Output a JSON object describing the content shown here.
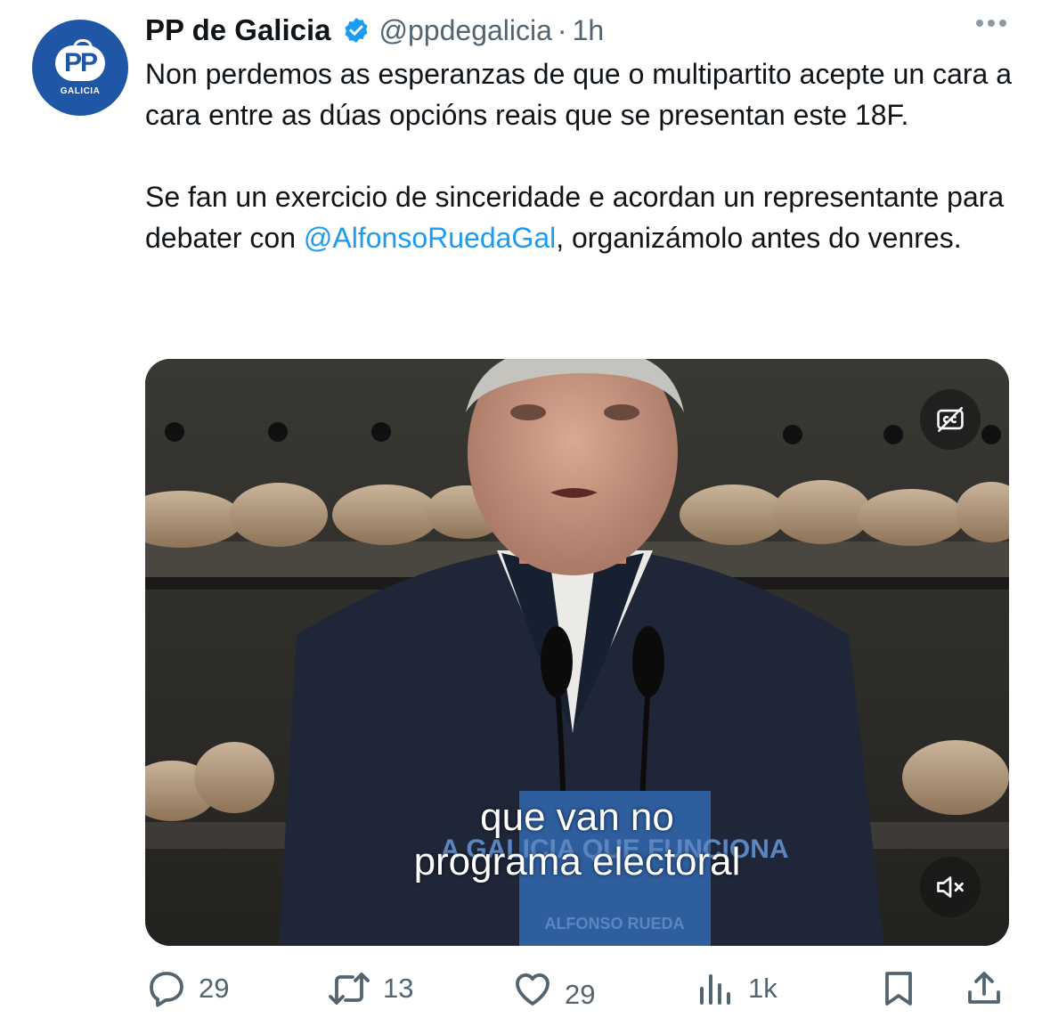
{
  "tweet": {
    "author_name": "PP de Galicia",
    "handle": "@ppdegalicia",
    "separator": "·",
    "time": "1h",
    "avatar": {
      "logo_text": "PP",
      "subtitle": "GALICIA",
      "color": "#1f56a6"
    },
    "text_lines_1": "Non perdemos as esperanzas de que o multipartito acepte un cara a cara entre as dúas opcións reais que se presentan este 18F.",
    "text_2_before": "Se fan un exercicio de sinceridade e acordan un representante para debater con ",
    "mention": "@AlfonsoRuedaGal",
    "text_2_after": ", organizámolo antes do venres.",
    "mention_color": "#1d9bf0",
    "verified_color": "#1d9bf0"
  },
  "media": {
    "caption_line1": "que van no",
    "caption_line2": "programa electoral",
    "podium_text": "A GALICIA QUE FUNCIONA",
    "podium_subtext": "ALFONSO RUEDA",
    "cc_icon": "closed-captions-off-icon",
    "mute_icon": "speaker-muted-icon"
  },
  "actions": {
    "replies": "29",
    "reposts": "13",
    "likes": "29",
    "views": "1k",
    "icon_color": "#536471"
  }
}
